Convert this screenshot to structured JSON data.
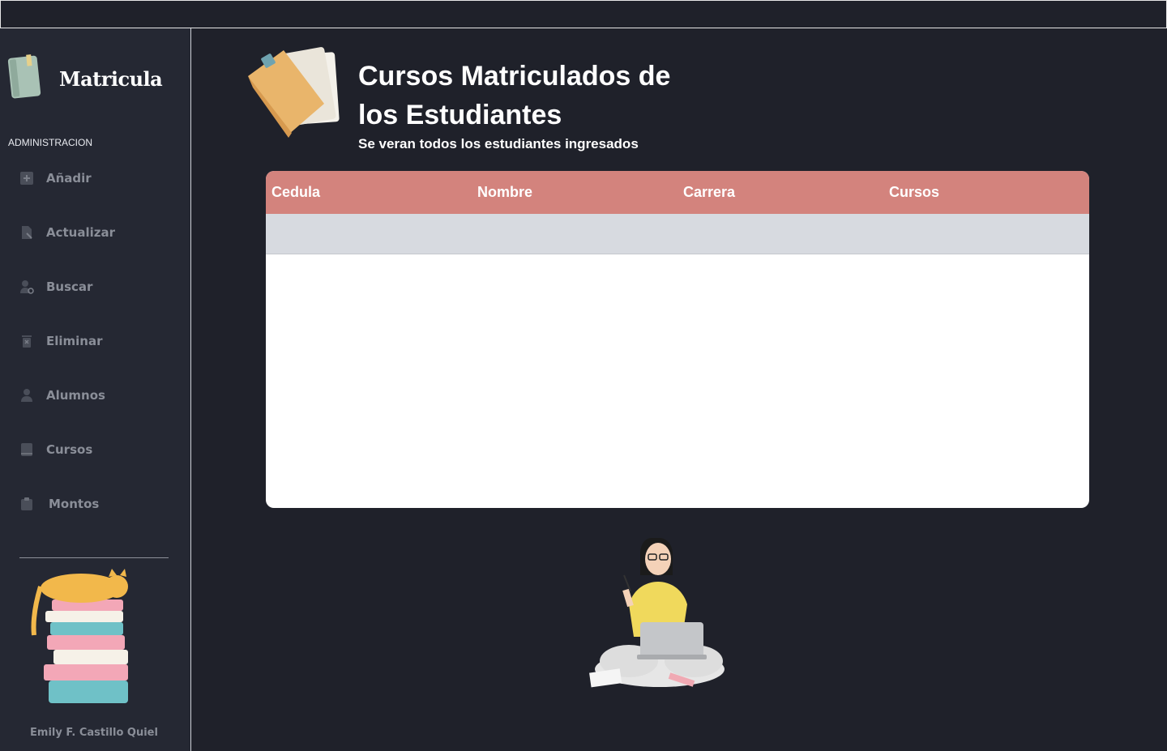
{
  "app": {
    "name": "Matricula"
  },
  "sidebar": {
    "section_label": "ADMINISTRACION",
    "items": [
      {
        "label": "Añadir",
        "icon": "plus-square-icon"
      },
      {
        "label": "Actualizar",
        "icon": "file-edit-icon"
      },
      {
        "label": "Buscar",
        "icon": "user-search-icon"
      },
      {
        "label": "Eliminar",
        "icon": "trash-icon"
      },
      {
        "label": "Alumnos",
        "icon": "user-icon"
      },
      {
        "label": "Cursos",
        "icon": "book-icon"
      },
      {
        "label": "Montos",
        "icon": "clipboard-icon"
      }
    ],
    "author": "Emily F. Castillo Quiel"
  },
  "main": {
    "title_line1": "Cursos Matriculados de",
    "title_line2": "los Estudiantes",
    "subtitle": "Se veran todos los estudiantes ingresados",
    "table": {
      "columns": [
        "Cedula",
        "Nombre",
        "Carrera",
        "Cursos"
      ],
      "rows": []
    }
  },
  "colors": {
    "background": "#1f212a",
    "sidebar": "#252833",
    "table_header": "#d3837d",
    "row": "#d7dae0",
    "nav_text": "#8a8e98"
  }
}
